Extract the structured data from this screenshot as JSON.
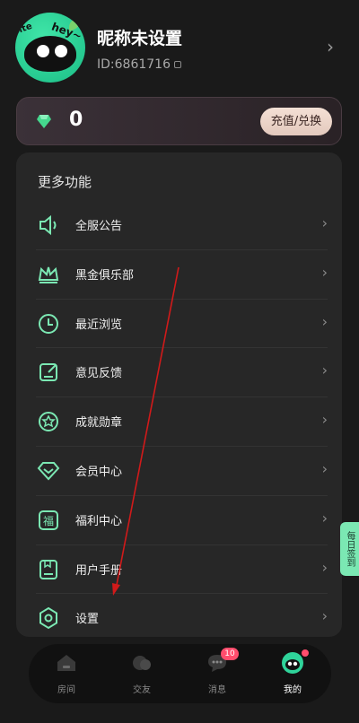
{
  "profile": {
    "nickname": "昵称未设置",
    "id_text": "ID:6861716",
    "avatar_text_left": "ite",
    "avatar_text_right": "hey~"
  },
  "wallet": {
    "amount": "0",
    "button_label": "充值/兑换"
  },
  "menu": {
    "title": "更多功能",
    "items": [
      {
        "label": "全服公告",
        "icon": "speaker-icon"
      },
      {
        "label": "黑金俱乐部",
        "icon": "crown-icon"
      },
      {
        "label": "最近浏览",
        "icon": "clock-icon"
      },
      {
        "label": "意见反馈",
        "icon": "feedback-icon"
      },
      {
        "label": "成就勋章",
        "icon": "medal-icon"
      },
      {
        "label": "会员中心",
        "icon": "vip-diamond-icon"
      },
      {
        "label": "福利中心",
        "icon": "welfare-icon"
      },
      {
        "label": "用户手册",
        "icon": "manual-icon"
      },
      {
        "label": "设置",
        "icon": "settings-icon"
      }
    ]
  },
  "side_tag": "每日签到",
  "nav": {
    "tabs": [
      {
        "label": "房间",
        "icon": "room-icon"
      },
      {
        "label": "交友",
        "icon": "friends-icon"
      },
      {
        "label": "消息",
        "icon": "message-icon",
        "badge": "10"
      },
      {
        "label": "我的",
        "icon": "profile-icon"
      }
    ],
    "active": "我的"
  },
  "colors": {
    "accent": "#7be8b3",
    "badge": "#ff4d6d",
    "annotation_arrow": "#d11a1a"
  }
}
